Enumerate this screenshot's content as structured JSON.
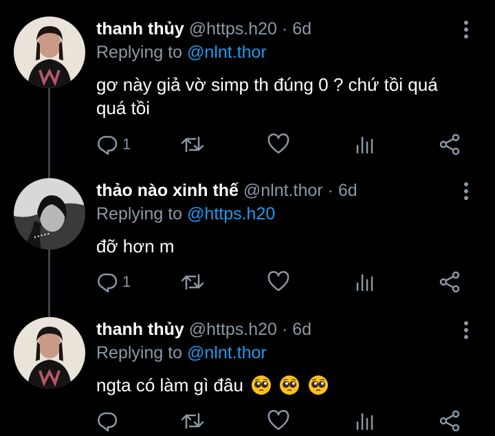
{
  "tweets": [
    {
      "name": "thanh thủy",
      "handle": "@https.h20",
      "sep": "·",
      "time": "6d",
      "replying_label": "Replying to",
      "replying_handle": "@nlnt.thor",
      "text": "gơ này giả vờ simp th đúng 0 ? chứ tồi quá quá tồi",
      "reply_count": "1",
      "emojis": []
    },
    {
      "name": "thảo nào xinh thế",
      "handle": "@nlnt.thor",
      "sep": "·",
      "time": "6d",
      "replying_label": "Replying to",
      "replying_handle": "@https.h20",
      "text": "đỡ hơn m",
      "reply_count": "1",
      "emojis": []
    },
    {
      "name": "thanh thủy",
      "handle": "@https.h20",
      "sep": "·",
      "time": "6d",
      "replying_label": "Replying to",
      "replying_handle": "@nlnt.thor",
      "text": "ngta có làm gì đâu",
      "reply_count": "",
      "emojis": [
        "pleading-face",
        "pleading-face",
        "pleading-face"
      ]
    }
  ],
  "icons": {
    "more": "more-vertical-icon",
    "reply": "reply-icon",
    "retweet": "retweet-icon",
    "like": "heart-icon",
    "stats": "stats-icon",
    "share": "share-icon"
  },
  "colors": {
    "background": "#000000",
    "text": "#ffffff",
    "secondary": "#8b98a5",
    "link": "#1d9bf0",
    "thread_line": "#3d4148"
  }
}
